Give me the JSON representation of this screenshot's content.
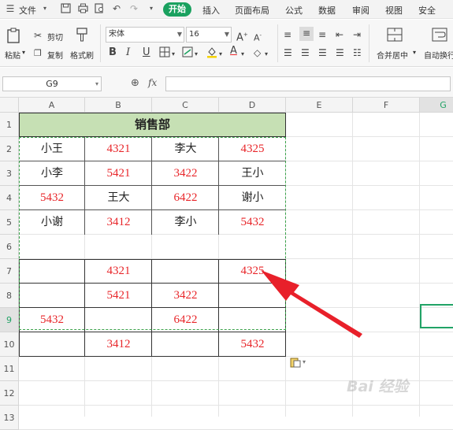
{
  "menubar": {
    "file_label": "文件",
    "tabs": [
      "开始",
      "插入",
      "页面布局",
      "公式",
      "数据",
      "审阅",
      "视图",
      "安全"
    ]
  },
  "ribbon": {
    "paste": "粘贴",
    "cut": "剪切",
    "copy": "复制",
    "format_painter": "格式刷",
    "font_name": "宋体",
    "font_size": "16",
    "merge_center": "合并居中",
    "auto_wrap": "自动换行"
  },
  "formula_bar": {
    "name_box": "G9",
    "fx_label": "fx",
    "formula": ""
  },
  "sheet": {
    "columns": [
      "A",
      "B",
      "C",
      "D",
      "E",
      "F",
      "G"
    ],
    "rows": [
      "1",
      "2",
      "3",
      "4",
      "5",
      "6",
      "7",
      "8",
      "9",
      "10",
      "11",
      "12",
      "13"
    ],
    "title": "销售部",
    "table1": [
      [
        "小王",
        "4321",
        "李大",
        "4325"
      ],
      [
        "小李",
        "5421",
        "3422",
        "王小"
      ],
      [
        "5432",
        "王大",
        "6422",
        "谢小"
      ],
      [
        "小谢",
        "3412",
        "李小",
        "5432"
      ]
    ],
    "table2": [
      [
        "",
        "4321",
        "",
        "4325"
      ],
      [
        "",
        "5421",
        "3422",
        ""
      ],
      [
        "5432",
        "",
        "6422",
        ""
      ],
      [
        "",
        "3412",
        "",
        "5432"
      ]
    ]
  },
  "watermark": "Bai 经验",
  "colors": {
    "accent_green": "#1aa15f",
    "number_red": "#e8262a",
    "title_fill": "#c6e0b4",
    "arrow_red": "#e8202a",
    "selection_green": "#21a366"
  }
}
